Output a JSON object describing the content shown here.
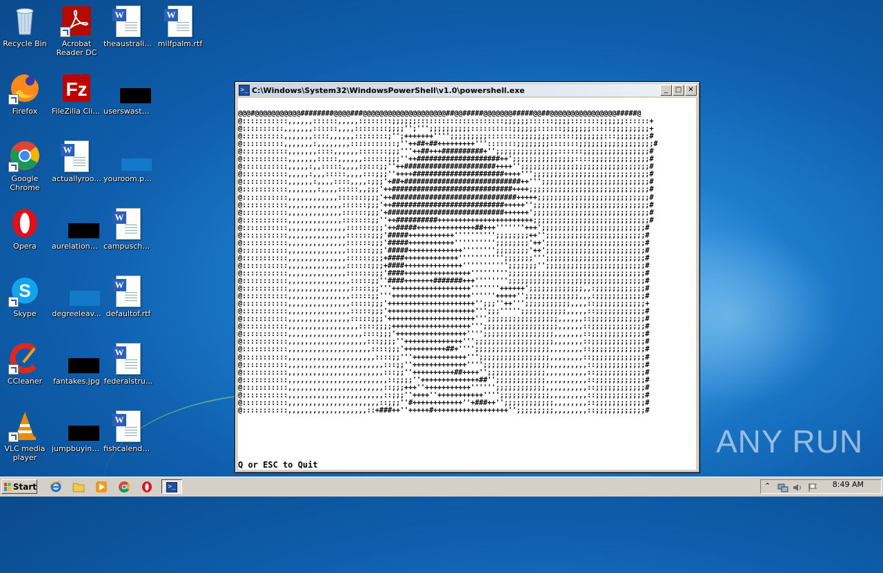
{
  "desktop": {
    "icons": [
      {
        "label": "Recycle Bin",
        "kind": "recycle-bin"
      },
      {
        "label": "Acrobat Reader DC",
        "kind": "acrobat"
      },
      {
        "label": "theaustralia...",
        "kind": "word-doc"
      },
      {
        "label": "milfpalm.rtf",
        "kind": "word-doc"
      },
      {
        "label": "Firefox",
        "kind": "firefox"
      },
      {
        "label": "FileZilla Client",
        "kind": "filezilla"
      },
      {
        "label": "userswaste...",
        "kind": "redacted-image"
      },
      {
        "label": "Google Chrome",
        "kind": "chrome"
      },
      {
        "label": "actuallyroo...",
        "kind": "word-doc"
      },
      {
        "label": "youroom.png",
        "kind": "image"
      },
      {
        "label": "Opera",
        "kind": "opera"
      },
      {
        "label": "aurelationsh...",
        "kind": "redacted-image"
      },
      {
        "label": "campuschar...",
        "kind": "word-doc"
      },
      {
        "label": "Skype",
        "kind": "skype"
      },
      {
        "label": "degreeleav...",
        "kind": "image"
      },
      {
        "label": "defaultof.rtf",
        "kind": "word-doc"
      },
      {
        "label": "CCleaner",
        "kind": "ccleaner"
      },
      {
        "label": "fantakes.jpg",
        "kind": "redacted-image"
      },
      {
        "label": "federalstru...",
        "kind": "word-doc"
      },
      {
        "label": "VLC media player",
        "kind": "vlc"
      },
      {
        "label": "jumpbuying...",
        "kind": "redacted-image"
      },
      {
        "label": "fishcalendar...",
        "kind": "word-doc"
      }
    ]
  },
  "powershell": {
    "title": "C:\\Windows\\System32\\WindowsPowerShell\\v1.0\\powershell.exe",
    "buttons": {
      "minimize": "_",
      "maximize": "□",
      "close": "✕"
    },
    "ascii_art": "@@@#@@@@@@@@@@@########@@@@###@@@@@@@@@@@@@@@@@@@@##@@#####@@@@@@@#####@@##@@@@@@@@@@@@@@@@#####@\n@:::::::::::,,,,,,::::::,,,,,::::::::;;;;;;:::::::::::::::::::::;;;;;;::::::;;;;:::::::;;;;;;::::::+\n@::::::::::,,,,,,,::::::,,,,::::::::;;;;'';''';;;;;;;;;;::::::::::;;;;;;::::::;;;;;;;:::::;;;;;;;;;+\n@::::::::::,,,,,,,::::,,,,,,::::::::;'';+++++++'''';;;;;;;;;::::::::;;;;;;;::::::;;;;;;;:::;;;;;;;;#\n@::::::::::,,,,,,,:,,,,,,,,:::::::::::;''++##+##+++++++++''':::::::;;;;;;;;:::::::;;;;;;;;;;;;;;;;;;#\n@:::::::::::,,,,,,,::::,,,,,,:::::::;;;'''++##+++##########+'';;;;;;;;;;;;;;;::::::;;;;;;;;;;;;;;;;#\n@:::::::::::,,,,,,,:::::,,,,,,::::::;;;''++####################++';;;;;;;;;;;;;;;::::;;;;;;;;;;;;;;#\n@:::::::::::,,,,,:,,:::::,,,,:::::;;''++######################++++'';;;;;;;;;;;;;;;;;;;;;;;;;;;;;;;#\n@:::::::::::,,,,,:,,,:::::,,,,:::;;;''++++######################++++''';;;;;;;;;;;;;;;;;;;;;;;;;;;;#\n@:::::::::::,,,,,,:,,,,::::,,,,:;;;'+##+############################++''';;;;;;;;;;;;;;;;;;;;;;;;;;#\n@:::::::::::,,,,,,,:,,,,:::::,,;;;'++#############################++++;;;;;;;;;;;;;;;;;;;;;;;;;;;;;#\n@:::::::::::,,,,,,,,,,,,:::::::;;;'++##############################+++++;;;;;;;;;;;;;;;;;;;;;;;;;;;#\n@:::::::::::,,,,,,,,,,,,,::::::;;;'++###########################+++++'';;;;;;;;;;;;;;;;;;;;;;;;;;;;#\n@:::::::::::,,,,,,,,,,,,,::::::;;;'+############################++++++';;;;;;;;;;;;;;;;;;;;;;;;;;;;#\n@:::::::::::,,,,,,,,,,,,,:::::::;;''++##########+++++++++++++++++++++++;;;;;;;;;;;;;;;;;;;;;;;;;;;;#\n@:::::::::::,,,,,,,,,,,,,,::::::;;;'++#####++++++++++++++##+++'''''''+++';;;;;;;;;;;;;;;;;;;;;;;;;#\n@:::::::::::,,,,,,,,,,,,,,::::::;;;'#####+++++++++++'''''''''';;;;;;;;++'';;;;;;;;;;;;;;;;;;;;;;;;#\n@:::::::::::,,,,,,,,,,,,,,::::::;;;'#####+++++++++++'''''''''';;;;;;;;'++';;;;;;;;;;;;;;;;;;;;;;;;#\n@:::::::::::,,,,,,,,,,,,,,::::::;;;'#####+++++++++++++'''''''';;;;;;;;'++';;;;;;;;;;;;;;;;;;;;;;;;#\n@:::::::::::,,,,,,,,,,,,,,::::::;;;+####+++++++++++++''''''''''';;;;;;;''';;;;;;;;;;;;;;;;;;;;;;;;#\n@:::::::::::,,,,,,,,,,,,,,::::::;;;+####++++++++++++++''''''''''';;;;;;;'';;;;;;;;;;;;;;;;;;;;;;;;#\n@:::::::::::,,,,,,,,,,,,,,::::::;;;'####++++++++++++++++''''''''';;;;;;;;;;;;;;;;;;;;;;;;;;;;;;;;;#\n@:::::::::::,,,,,,,,,,,,,,,:::::;;''####+++++++#######+++'''''''';;;;;;;;;;;;;;;;;;;;;;;;;;;;;;;;;#\n@:::::::::::,,,,,,,,,,,,,,,:::::;;'''+++++++++++++++++++'''''''++++++';;;;;;;;;;;;;,,:;;;;;;;;;;;;#\n@:::::::::::,,,,,,,,,,,,,,,:::::;;'''+++++++++++++++++++''''''+++++'';;;;;;;;;;;;;,,,:;;;;;;;;;;;;#\n@:::::::::::,,,,,,,,,,,,,,,:::::;;;'+++++++++++++++++++++'';;;''++''';;;;;;;;;;;,,,,::;;;;;;;;;;;;+\n@:::::::::::,,,,,,,,,,,,,,,:::::;;;'+++++++++++++++++++++''';;;''''';;;;;;;;;;;,,,,,::;;;;;;;;;;;;#\n@:::::::::::,,,,,,,,,,,,,,,:::::;;;'+++++++++++++++++++++''';;;;;;;;;;;;;;;;;,,,,,,::;;;;;;;;;;;;;#\n@:::::::::::,,,,,,,,,,,,,,,,,::::;;;;+++++++++++++++++++''';;;;;;;;;;;;;;;;;;,,,,,,::;;;;;;;;;;;;;#\n@:::::::::::,,,,,,,,,,,,,,,,,,::::;;;'+++++++++++++++++'''';;;;;;;;;;;;;;;;;,,,,,,,::;;;;;;;;;;;;;#\n@:::::::::::,,,,,,,,,,,,,,,,,,,:::;;;;''++++++++++++++''';;;;;;;;;;;;;;;;;;;,,,,,,,::;;;;;;;;;;;;;#\n@:::::::::::,,,,,,,,,,,,,,,,,,,,::::;;;'++++++++++##+'''';;;;;;;;;;;;;;;;;;,,,,,,,,::;;;;;;;;;;;;;#\n@:::::::::::,,,,,,,,,,,,,,,,,,,,,::::;;'''+++++++++++++''';;;;;;;;;;;;;;;;;,,,,,,,,::;;;;;;;;;;;;;#\n@:::::::::::,,,,,,,,,,,,,,,,,,,,,,,:::;;''+++++++++++++'''';;;;;;;;;;;;;;;;,,,,,,,,,::;;;;;;;;;;;;#\n@:::::::::::,,,,,,,,,,,,,,,,,,,,,,,:::;;''++++++++++##++++'';;;;;;;;;;;;;;,,,,,,,,,,::;;;;;;;;;;;;#\n@:::::::::::,,,,,,,,,,,,,,,,,,,,,,,,::;;;;''++++++++++++++##'';;;;;;;;;;;;,,,,,,,,,,::;;;;;;;;;;;;#\n@:::::::::::,,,,,,,,,,,,,,,,,,,,,,,::;;;+++''+++++++++++'''''';;;;;;;;;;;;,,,,,,,,,,::;;;;;;;;;;;;#\n@:::::::::::,,,,,,,,,,,,,,,,,,,,,,,::;;;''++++''+++++++++++'''';;;;;;;;;;;;,,,,,,,,,::;;;;;;;;;;;;#\n@:::::::::::,,,,,,,,,,,,,,,,,,,,,,::;;;''#++++++++++++''+###++'';;;;;;;;;;;;,,,,,,,,::;;;;;;;;;;;;#\n@:::::::::::,,,,,,,,,,,,,,,,,,,::+###++''+++++#++++++++++++++++++'';;;;;;;;;,,,,,,,,::;;;;;;;;;;;;#",
    "quit_hint": "Q or ESC to Quit"
  },
  "taskbar": {
    "start_label": "Start",
    "clock": "8:49 AM"
  },
  "watermark": {
    "text": "ANY RUN"
  }
}
